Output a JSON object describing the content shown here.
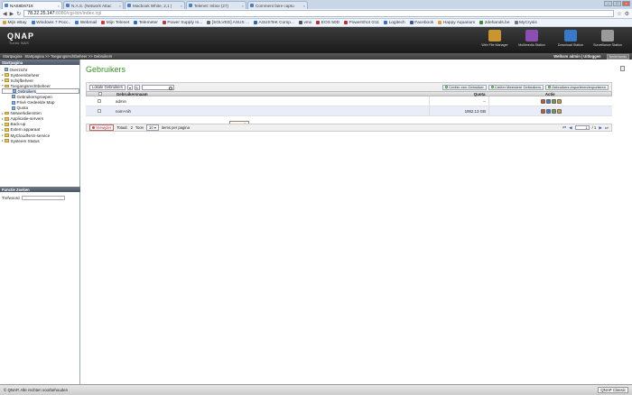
{
  "browser": {
    "tabs": [
      {
        "label": "NAS8D6716",
        "active": true
      },
      {
        "label": "N.A.S. (Network Attac",
        "active": false
      },
      {
        "label": "Macbook White, 2,1 |",
        "active": false
      },
      {
        "label": "Telenet: Inbox (27)",
        "active": false
      },
      {
        "label": "Comment faire captu",
        "active": false
      }
    ],
    "url_host": "78.22.25.147",
    "url_path": ":8080/cgi-bin/index.cgi",
    "bookmarks": [
      "Mijn eBay",
      "Windows 7 Pocc..",
      "Webmail",
      "Mijn Telenet",
      "Telemeter",
      "Power Supply In...",
      "[SOLVED] ASUS ...",
      "ASUSTeK Comp...",
      "vmx",
      "EOS 50D",
      "PowerShot G11",
      "Logitech",
      "Facebook",
      "Happy Aquarium",
      "2dehands.be",
      "MyCrysis"
    ]
  },
  "qnap": {
    "logo": "QNAP",
    "logo_sub": "Turbo NAS",
    "header_icons": [
      {
        "label": "Web File Manager",
        "icon": "folder-globe-icon",
        "color": "#c9952f"
      },
      {
        "label": "Multimedia Station",
        "icon": "multimedia-icon",
        "color": "#8a4fb0"
      },
      {
        "label": "Download Station",
        "icon": "download-icon",
        "color": "#3a78c8"
      },
      {
        "label": "Surveillance Station",
        "icon": "camera-icon",
        "color": "#9a9a9a"
      }
    ],
    "breadcrumb": "Startpagina >> Toegangsrechtbeheer >> Gebruikers",
    "welcome": "Welkom admin | Uitloggen",
    "language": "Nederlands"
  },
  "sidebar": {
    "header": "Startpagina",
    "items": [
      {
        "label": "Overzicht",
        "level": 0,
        "type": "page",
        "expand": ""
      },
      {
        "label": "Systeembeheer",
        "level": 0,
        "type": "folder",
        "expand": "+"
      },
      {
        "label": "Schijfbeheer",
        "level": 0,
        "type": "folder",
        "expand": "+"
      },
      {
        "label": "Toegangsrechtbeheer",
        "level": 0,
        "type": "folder",
        "expand": "-"
      },
      {
        "label": "Gebruikers",
        "level": 1,
        "type": "page",
        "expand": "",
        "selected": true
      },
      {
        "label": "Gebruikersgroepen",
        "level": 1,
        "type": "page",
        "expand": ""
      },
      {
        "label": "Privé Gedeelde Map",
        "level": 1,
        "type": "page",
        "expand": ""
      },
      {
        "label": "Quota",
        "level": 1,
        "type": "page",
        "expand": ""
      },
      {
        "label": "Netwerkdiensten",
        "level": 0,
        "type": "folder",
        "expand": "+"
      },
      {
        "label": "Applicatie-servers",
        "level": 0,
        "type": "folder",
        "expand": "+"
      },
      {
        "label": "Back-up",
        "level": 0,
        "type": "folder",
        "expand": "+"
      },
      {
        "label": "Extern apparaat",
        "level": 0,
        "type": "folder",
        "expand": "+"
      },
      {
        "label": "MyCloudNAS-service",
        "level": 0,
        "type": "folder",
        "expand": "+"
      },
      {
        "label": "Systeem Status",
        "level": 0,
        "type": "folder",
        "expand": "+"
      }
    ],
    "func_header": "Functie Zoeken",
    "search_label": "Trefwoord"
  },
  "main": {
    "title": "Gebruikers",
    "filter_select": "Lokale Gebruikers",
    "buttons": {
      "create_user": "Creëer een Gebruiker",
      "create_multiple": "Creëer Meerdere Gebruikers",
      "import_export": "Gebruikers importeren/exporteren"
    },
    "columns": {
      "name": "Gebruikersnaam",
      "quota": "Quota",
      "action": "Actie"
    },
    "rows": [
      {
        "name": "admin",
        "quota": "--"
      },
      {
        "name": "nom+nih",
        "quota": "1952.13 GB"
      }
    ],
    "tooltip": "nom+nih",
    "pager": {
      "delete": "Verwijder",
      "total_label": "Totaal:",
      "total": "2",
      "show_label": "Toon",
      "per_page": "10",
      "per_page_suffix": "items per pagina",
      "page": "1",
      "of": "/ 1"
    }
  },
  "statusbar": {
    "copyright": "© QNAP, Alle rechten voorbehouden",
    "mode": "QNAP Classic"
  }
}
